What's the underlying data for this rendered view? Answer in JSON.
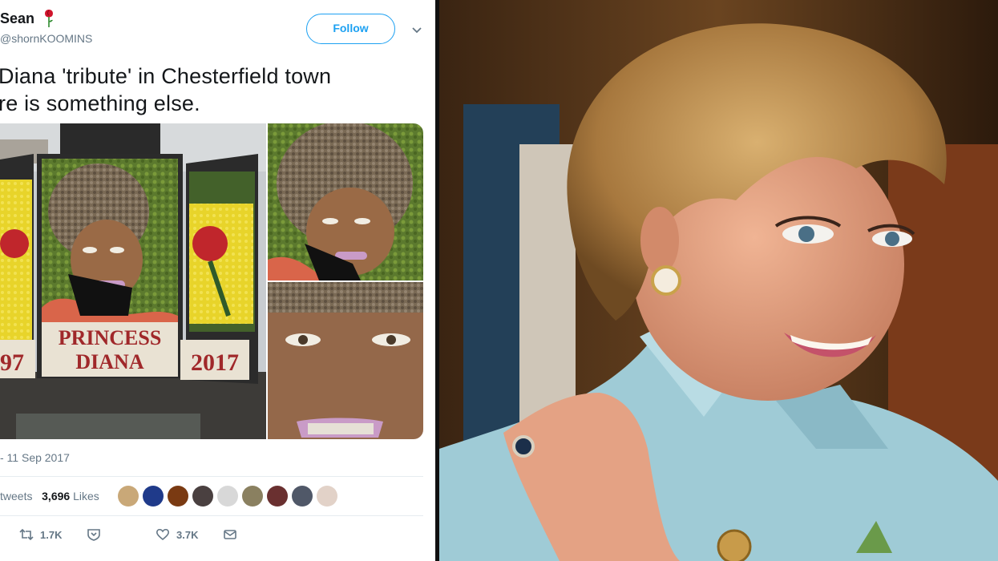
{
  "tweet": {
    "name": "Sean",
    "handle": "@shornKOOMINS",
    "follow_label": "Follow",
    "text_line1": "Diana 'tribute' in Chesterfield town",
    "text_line2": "re is something else.",
    "date": "- 11 Sep 2017",
    "retweets_label": "tweets",
    "likes_count": "3,696",
    "likes_label": "Likes",
    "reply_count": "1.7K",
    "like_count": "3.7K",
    "media": {
      "sign_line1": "PRINCESS",
      "sign_line2": "DIANA",
      "year_left": "97",
      "year_right": "2017"
    }
  },
  "icons": [
    "rose-emoji-icon",
    "chevron-down-icon",
    "retweet-icon",
    "shield-icon",
    "heart-icon",
    "message-icon"
  ],
  "colors": {
    "accent": "#1da1f2",
    "text": "#14171a",
    "secondary": "#657786",
    "divider": "#e6ecf0"
  }
}
